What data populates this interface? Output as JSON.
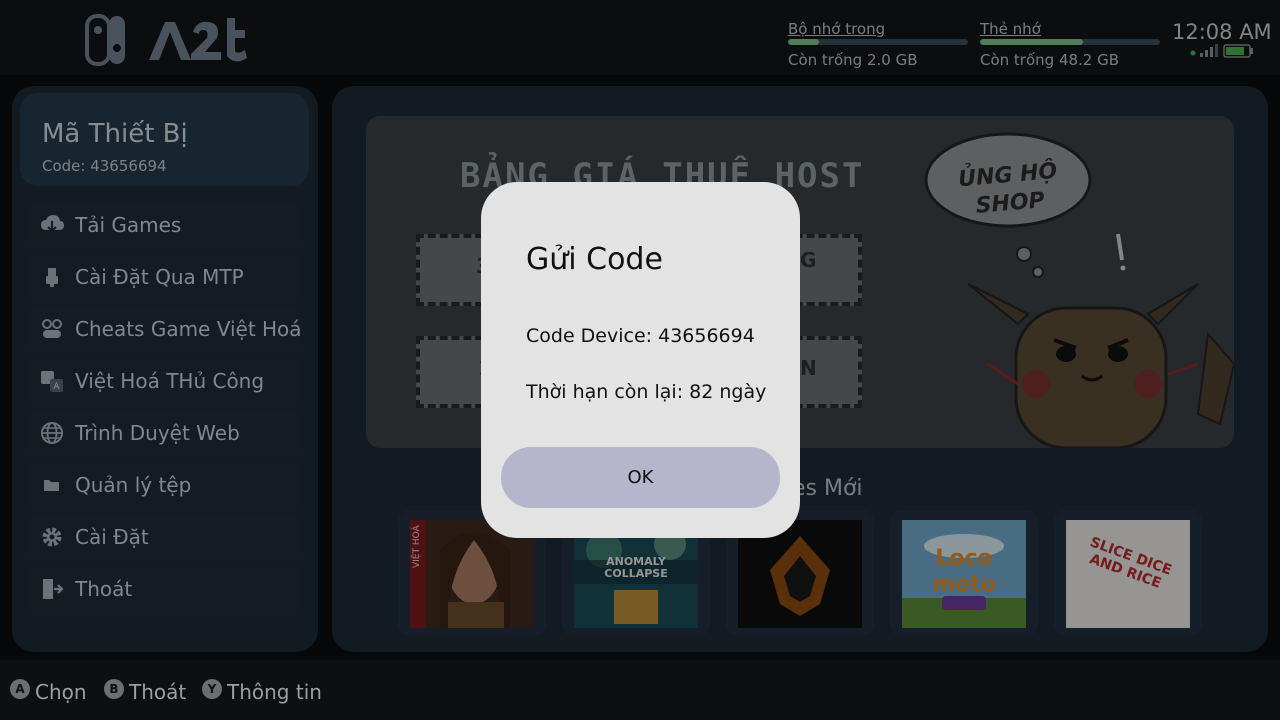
{
  "topbar": {
    "internal_storage": {
      "label": "Bộ nhớ trong",
      "free": "Còn trống 2.0 GB",
      "used_fraction": 0.17
    },
    "sd_card": {
      "label": "Thẻ nhớ",
      "free": "Còn trống 48.2 GB",
      "used_fraction": 0.57
    },
    "clock": "12:08 AM"
  },
  "sidebar": {
    "device_title": "Mã Thiết Bị",
    "device_code": "Code: 43656694",
    "items": [
      {
        "label": "Tải Games",
        "icon": "download-cloud-icon"
      },
      {
        "label": "Cài Đặt Qua MTP",
        "icon": "usb-icon"
      },
      {
        "label": "Cheats Game Việt Hoá",
        "icon": "gamepad-icon"
      },
      {
        "label": "Việt Hoá THủ Công",
        "icon": "translate-icon"
      },
      {
        "label": "Trình Duyệt Web",
        "icon": "globe-icon"
      },
      {
        "label": "Quản lý tệp",
        "icon": "folder-icon"
      },
      {
        "label": "Cài Đặt",
        "icon": "gear-icon"
      },
      {
        "label": "Thoát",
        "icon": "exit-icon"
      }
    ]
  },
  "main": {
    "banner": {
      "title": "BẢNG GIÁ THUÊ HOST",
      "bubble_text": "ỦNG HỘ SHOP"
    },
    "games_title": "es Mới",
    "games": [
      {
        "name": "game-1",
        "badge": "VIỆT HOÁ"
      },
      {
        "name": "game-2",
        "title": "ANOMALY COLLAPSE"
      },
      {
        "name": "game-3"
      },
      {
        "name": "game-4",
        "title": "Loco moto"
      },
      {
        "name": "game-5",
        "title": "SLICE DICE AND RICE"
      }
    ]
  },
  "dialog": {
    "title": "Gửi Code",
    "code_line": "Code Device: 43656694",
    "days_line": "Thời hạn còn lại: 82 ngày",
    "ok_label": "OK"
  },
  "bottombar": {
    "hints": [
      {
        "glyph": "A",
        "label": "Chọn"
      },
      {
        "glyph": "B",
        "label": "Thoát"
      },
      {
        "glyph": "Y",
        "label": "Thông tin"
      }
    ]
  },
  "colors": {
    "panel": "#1d2935",
    "accent_bar": "#7fbf8f",
    "dialog_bg": "#e3e3e3",
    "ok_button": "#b5b5cc"
  }
}
